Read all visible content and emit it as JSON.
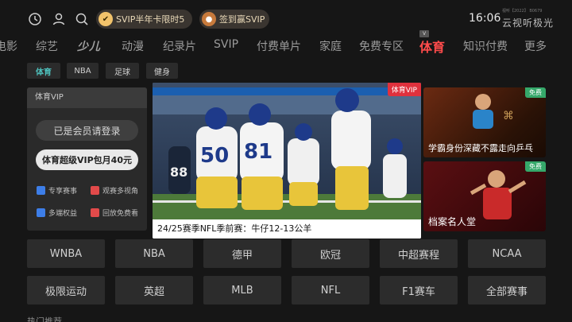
{
  "topbar": {
    "icons": [
      "history-icon",
      "user-icon",
      "search-icon"
    ],
    "promo_svip": "SVIP半年卡限时5",
    "promo_signin": "签到赢SVIP",
    "time": "16:06",
    "brand_small": "视听【2022】 B0679",
    "brand_name": "云视听极光"
  },
  "nav": {
    "items": [
      "电影",
      "综艺",
      "少儿",
      "动漫",
      "纪录片",
      "SVIP",
      "付费单片",
      "家庭",
      "免费专区",
      "体育",
      "知识付费",
      "更多"
    ],
    "active": "体育",
    "v_badge": "V"
  },
  "subtabs": [
    "体育",
    "NBA",
    "足球",
    "健身"
  ],
  "vip_panel": {
    "title": "体育VIP",
    "login_btn": "已是会员请登录",
    "buy_btn": "体育超级VIP包月40元",
    "perks": [
      "专享赛事",
      "观赛多视角",
      "多端权益",
      "回放免费看"
    ]
  },
  "main_video": {
    "tag": "体育VIP",
    "caption": "24/25赛季NFL季前赛：牛仔12-13公羊",
    "jersey_numbers": [
      "50",
      "88",
      "81"
    ]
  },
  "thumbs": [
    {
      "badge": "免费",
      "caption": "学霸身份深藏不露走向乒乓"
    },
    {
      "badge": "免费",
      "caption": "档案名人堂"
    }
  ],
  "categories": [
    "WNBA",
    "NBA",
    "德甲",
    "欧冠",
    "中超赛程",
    "NCAA",
    "极限运动",
    "英超",
    "MLB",
    "NFL",
    "F1赛车",
    "全部赛事"
  ],
  "bottom_hint": "热门推荐",
  "colors": {
    "accent_red": "#ff4b4b",
    "accent_teal": "#4ec0bc",
    "free_green": "#35a86a",
    "vip_red": "#e0313d"
  }
}
